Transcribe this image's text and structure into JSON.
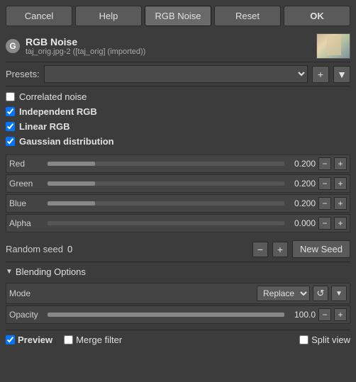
{
  "toolbar": {
    "cancel": "Cancel",
    "help": "Help",
    "rgb_noise": "RGB Noise",
    "reset": "Reset",
    "ok": "OK"
  },
  "header": {
    "icon_letter": "G",
    "title": "RGB Noise",
    "subtitle": "taj_orig.jpg-2 ([taj_orig] (imported))"
  },
  "presets": {
    "label": "Presets:"
  },
  "checkboxes": {
    "correlated": "Correlated noise",
    "independent": "Independent RGB",
    "linear": "Linear RGB",
    "gaussian": "Gaussian distribution"
  },
  "sliders": [
    {
      "label": "Red",
      "value": "0.200",
      "fill_pct": 20
    },
    {
      "label": "Green",
      "value": "0.200",
      "fill_pct": 20
    },
    {
      "label": "Blue",
      "value": "0.200",
      "fill_pct": 20
    },
    {
      "label": "Alpha",
      "value": "0.000",
      "fill_pct": 0
    }
  ],
  "seed": {
    "label": "Random seed",
    "value": "0",
    "new_seed_label": "New Seed"
  },
  "blending": {
    "title": "Blending Options",
    "mode_label": "Mode",
    "mode_value": "Replace",
    "opacity_label": "Opacity",
    "opacity_value": "100.0"
  },
  "footer": {
    "preview_label": "Preview",
    "merge_label": "Merge filter",
    "split_label": "Split view"
  }
}
